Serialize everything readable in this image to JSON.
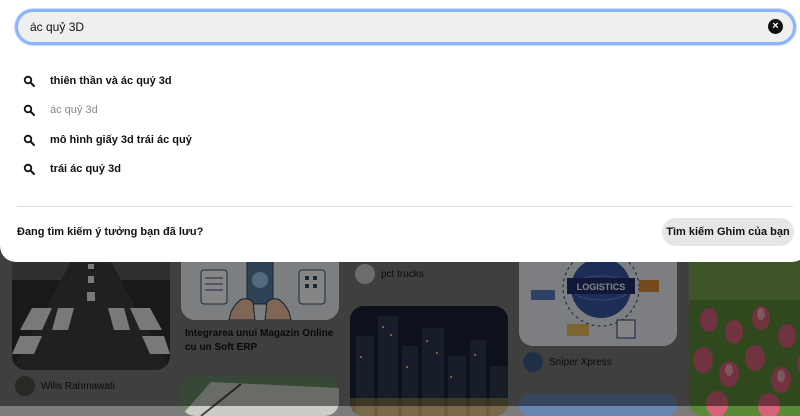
{
  "search": {
    "value": "ác quỷ 3D",
    "clear_icon": "clear-icon"
  },
  "suggestions": [
    {
      "label": "thiên thần và ác quỷ 3d",
      "muted": false,
      "icon": "search-icon"
    },
    {
      "label": "ác quỷ 3d",
      "muted": true,
      "icon": "search-icon"
    },
    {
      "label": "mô hình giấy 3d trái ác quỷ",
      "muted": false,
      "icon": "search-icon"
    },
    {
      "label": "trái ác quỷ 3d",
      "muted": false,
      "icon": "search-icon"
    }
  ],
  "saved_ideas": {
    "question": "Đang tìm kiếm ý tưởng bạn đã lưu?",
    "button_label": "Tìm kiếm Ghim của bạn"
  },
  "pins": {
    "pin1_author": "Wilis Rahmawati",
    "pin2_title": "Integrarea unui Magazin Online cu un Soft ERP",
    "pin3_author": "pct trucks",
    "pin4_logo_text": "LOGISTICS",
    "pin4_author": "Sniper Xpress"
  },
  "colors": {
    "search_border": "#8fb4ff",
    "search_bg": "#efefef",
    "panel_bg": "#ffffff",
    "overlay": "rgba(0,0,0,0.48)"
  }
}
